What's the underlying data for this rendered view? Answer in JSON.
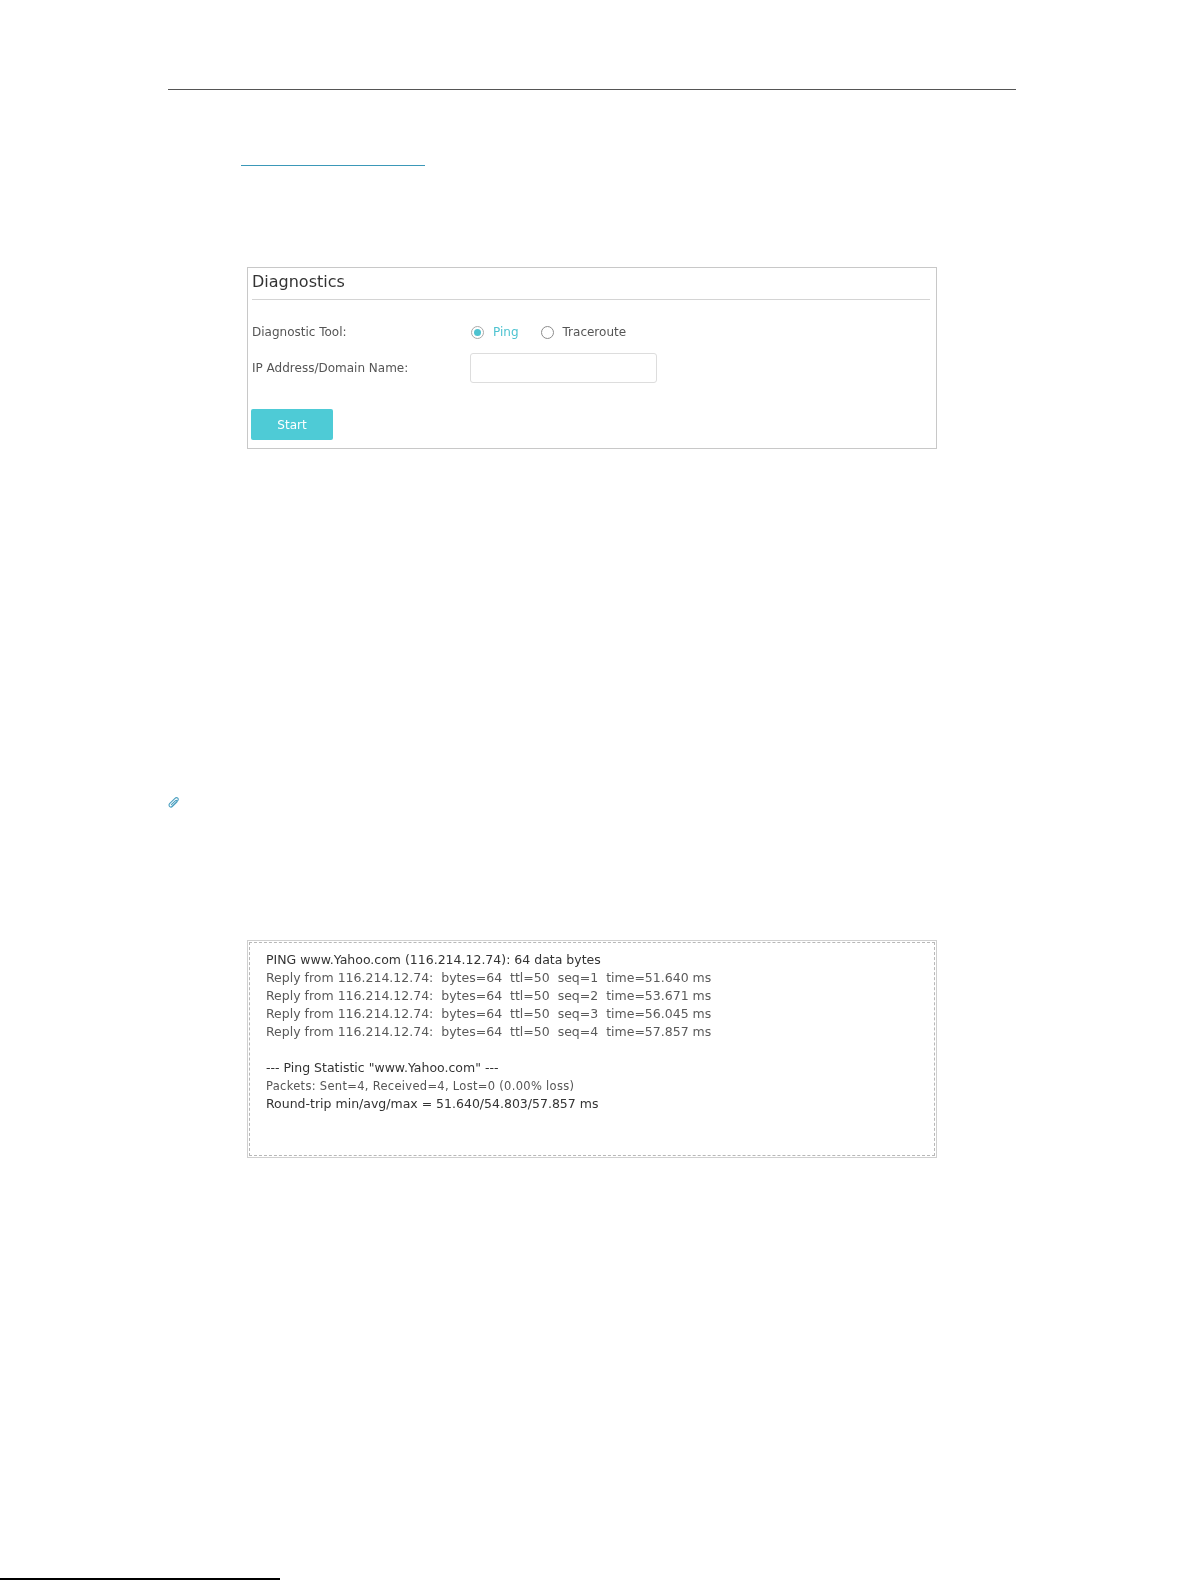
{
  "diagnostics": {
    "title": "Diagnostics",
    "tool_label": "Diagnostic Tool:",
    "tools": [
      {
        "label": "Ping",
        "selected": true
      },
      {
        "label": "Traceroute",
        "selected": false
      }
    ],
    "address_label": "IP Address/Domain Name:",
    "start_button": "Start"
  },
  "ping_output": {
    "blocks": [
      {
        "lines": [
          {
            "kind": "header",
            "text": "PING www.Yahoo.com (116.214.12.74): 64 data bytes"
          },
          {
            "kind": "reply",
            "text": "Reply from 116.214.12.74:  bytes=64  ttl=50  seq=1  time=51.640 ms"
          },
          {
            "kind": "reply",
            "text": "Reply from 116.214.12.74:  bytes=64  ttl=50  seq=2  time=53.671 ms"
          },
          {
            "kind": "reply",
            "text": "Reply from 116.214.12.74:  bytes=64  ttl=50  seq=3  time=56.045 ms"
          },
          {
            "kind": "reply",
            "text": "Reply from 116.214.12.74:  bytes=64  ttl=50  seq=4  time=57.857 ms"
          }
        ]
      },
      {
        "lines": [
          {
            "kind": "header",
            "text": "--- Ping Statistic \"www.Yahoo.com\" ---"
          },
          {
            "kind": "small",
            "text": "Packets: Sent=4, Received=4, Lost=0 (0.00% loss)"
          },
          {
            "kind": "header",
            "text": "Round-trip min/avg/max = 51.640/54.803/57.857 ms"
          }
        ]
      }
    ]
  }
}
